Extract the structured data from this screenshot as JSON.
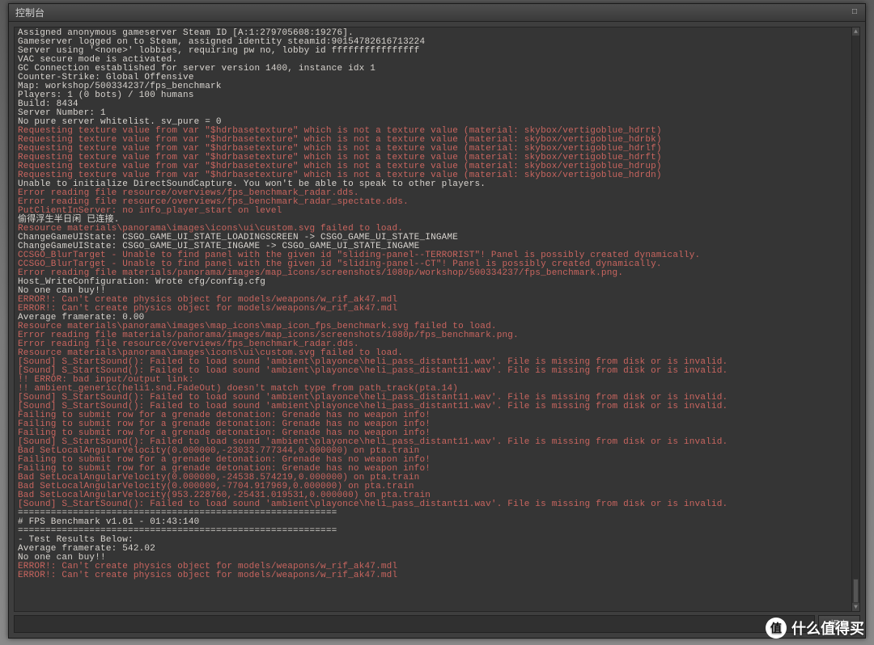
{
  "window": {
    "title": "控制台",
    "close_glyph": "□"
  },
  "input": {
    "value": "",
    "placeholder": "",
    "submit_label": "提交"
  },
  "watermark": {
    "badge": "值",
    "text": "什么值得买"
  },
  "colors": {
    "bg": "#3e3e3e",
    "text_white": "#d8d4cf",
    "text_red": "#c9655f"
  },
  "lines": [
    {
      "c": "white",
      "t": "Assigned anonymous gameserver Steam ID [A:1:279705608:19276]."
    },
    {
      "c": "white",
      "t": "Gameserver logged on to Steam, assigned identity steamid:90154782616713224"
    },
    {
      "c": "white",
      "t": "Server using '<none>' lobbies, requiring pw no, lobby id ffffffffffffffff"
    },
    {
      "c": "white",
      "t": "VAC secure mode is activated."
    },
    {
      "c": "white",
      "t": "GC Connection established for server version 1400, instance idx 1"
    },
    {
      "c": "white",
      "t": ""
    },
    {
      "c": "white",
      "t": "Counter-Strike: Global Offensive"
    },
    {
      "c": "white",
      "t": "Map: workshop/500334237/fps_benchmark"
    },
    {
      "c": "white",
      "t": "Players: 1 (0 bots) / 100 humans"
    },
    {
      "c": "white",
      "t": "Build: 8434"
    },
    {
      "c": "white",
      "t": "Server Number: 1"
    },
    {
      "c": "white",
      "t": ""
    },
    {
      "c": "white",
      "t": "No pure server whitelist. sv_pure = 0"
    },
    {
      "c": "red",
      "t": "Requesting texture value from var \"$hdrbasetexture\" which is not a texture value (material: skybox/vertigoblue_hdrrt)"
    },
    {
      "c": "red",
      "t": "Requesting texture value from var \"$hdrbasetexture\" which is not a texture value (material: skybox/vertigoblue_hdrbk)"
    },
    {
      "c": "red",
      "t": "Requesting texture value from var \"$hdrbasetexture\" which is not a texture value (material: skybox/vertigoblue_hdrlf)"
    },
    {
      "c": "red",
      "t": "Requesting texture value from var \"$hdrbasetexture\" which is not a texture value (material: skybox/vertigoblue_hdrft)"
    },
    {
      "c": "red",
      "t": "Requesting texture value from var \"$hdrbasetexture\" which is not a texture value (material: skybox/vertigoblue_hdrup)"
    },
    {
      "c": "red",
      "t": "Requesting texture value from var \"$hdrbasetexture\" which is not a texture value (material: skybox/vertigoblue_hdrdn)"
    },
    {
      "c": "white",
      "t": "Unable to initialize DirectSoundCapture. You won't be able to speak to other players."
    },
    {
      "c": "red",
      "t": "Error reading file resource/overviews/fps_benchmark_radar.dds."
    },
    {
      "c": "red",
      "t": "Error reading file resource/overviews/fps_benchmark_radar_spectate.dds."
    },
    {
      "c": "red",
      "t": "PutClientInServer: no info_player_start on level"
    },
    {
      "c": "white",
      "t": "偷得浮生半日闲 已连接."
    },
    {
      "c": "red",
      "t": "Resource materials\\panorama\\images\\icons\\ui\\custom.svg failed to load."
    },
    {
      "c": "white",
      "t": "ChangeGameUIState: CSGO_GAME_UI_STATE_LOADINGSCREEN -> CSGO_GAME_UI_STATE_INGAME"
    },
    {
      "c": "white",
      "t": "ChangeGameUIState: CSGO_GAME_UI_STATE_INGAME -> CSGO_GAME_UI_STATE_INGAME"
    },
    {
      "c": "red",
      "t": "CCSGO_BlurTarget - Unable to find panel with the given id \"sliding-panel--TERRORIST\"! Panel is possibly created dynamically."
    },
    {
      "c": "red",
      "t": "CCSGO_BlurTarget - Unable to find panel with the given id \"sliding-panel--CT\"! Panel is possibly created dynamically."
    },
    {
      "c": "red",
      "t": "Error reading file materials/panorama/images/map_icons/screenshots/1080p/workshop/500334237/fps_benchmark.png."
    },
    {
      "c": "white",
      "t": "Host_WriteConfiguration: Wrote cfg/config.cfg"
    },
    {
      "c": "white",
      "t": "No one can buy!!"
    },
    {
      "c": "red",
      "t": "ERROR!: Can't create physics object for models/weapons/w_rif_ak47.mdl"
    },
    {
      "c": "red",
      "t": "ERROR!: Can't create physics object for models/weapons/w_rif_ak47.mdl"
    },
    {
      "c": "white",
      "t": "Average framerate: 0.00"
    },
    {
      "c": "red",
      "t": "Resource materials\\panorama\\images\\map_icons\\map_icon_fps_benchmark.svg failed to load."
    },
    {
      "c": "red",
      "t": "Error reading file materials/panorama/images/map_icons/screenshots/1080p/fps_benchmark.png."
    },
    {
      "c": "red",
      "t": "Error reading file resource/overviews/fps_benchmark_radar.dds."
    },
    {
      "c": "red",
      "t": "Resource materials\\panorama\\images\\icons\\ui\\custom.svg failed to load."
    },
    {
      "c": "red",
      "t": "[Sound] S_StartSound(): Failed to load sound 'ambient\\playonce\\heli_pass_distant11.wav'. File is missing from disk or is invalid."
    },
    {
      "c": "red",
      "t": "[Sound] S_StartSound(): Failed to load sound 'ambient\\playonce\\heli_pass_distant11.wav'. File is missing from disk or is invalid."
    },
    {
      "c": "red",
      "t": "!! ERROR: bad input/output link:"
    },
    {
      "c": "red",
      "t": "!! ambient_generic(heli1.snd.FadeOut) doesn't match type from path_track(pta.14)"
    },
    {
      "c": "red",
      "t": "[Sound] S_StartSound(): Failed to load sound 'ambient\\playonce\\heli_pass_distant11.wav'. File is missing from disk or is invalid."
    },
    {
      "c": "red",
      "t": "[Sound] S_StartSound(): Failed to load sound 'ambient\\playonce\\heli_pass_distant11.wav'. File is missing from disk or is invalid."
    },
    {
      "c": "red",
      "t": "Failing to submit row for a grenade detonation: Grenade has no weapon info!"
    },
    {
      "c": "red",
      "t": "Failing to submit row for a grenade detonation: Grenade has no weapon info!"
    },
    {
      "c": "red",
      "t": "Failing to submit row for a grenade detonation: Grenade has no weapon info!"
    },
    {
      "c": "red",
      "t": "[Sound] S_StartSound(): Failed to load sound 'ambient\\playonce\\heli_pass_distant11.wav'. File is missing from disk or is invalid."
    },
    {
      "c": "red",
      "t": "Bad SetLocalAngularVelocity(0.000000,-23033.777344,0.000000) on pta.train"
    },
    {
      "c": "red",
      "t": "Failing to submit row for a grenade detonation: Grenade has no weapon info!"
    },
    {
      "c": "red",
      "t": "Failing to submit row for a grenade detonation: Grenade has no weapon info!"
    },
    {
      "c": "red",
      "t": "Bad SetLocalAngularVelocity(0.000000,-24538.574219,0.000000) on pta.train"
    },
    {
      "c": "red",
      "t": "Bad SetLocalAngularVelocity(0.000000,-7704.917969,0.000000) on pta.train"
    },
    {
      "c": "red",
      "t": "Bad SetLocalAngularVelocity(953.228760,-25431.019531,0.000000) on pta.train"
    },
    {
      "c": "red",
      "t": "[Sound] S_StartSound(): Failed to load sound 'ambient\\playonce\\heli_pass_distant11.wav'. File is missing from disk or is invalid."
    },
    {
      "c": "white",
      "t": ""
    },
    {
      "c": "white",
      "t": ""
    },
    {
      "c": "white",
      "t": "=========================================================="
    },
    {
      "c": "white",
      "t": "# FPS Benchmark v1.01 - 01:43:140"
    },
    {
      "c": "white",
      "t": "=========================================================="
    },
    {
      "c": "white",
      "t": "- Test Results Below:"
    },
    {
      "c": "white",
      "t": ""
    },
    {
      "c": "white",
      "t": "Average framerate: 542.02"
    },
    {
      "c": "white",
      "t": "No one can buy!!"
    },
    {
      "c": "red",
      "t": "ERROR!: Can't create physics object for models/weapons/w_rif_ak47.mdl"
    },
    {
      "c": "red",
      "t": "ERROR!: Can't create physics object for models/weapons/w_rif_ak47.mdl"
    }
  ]
}
